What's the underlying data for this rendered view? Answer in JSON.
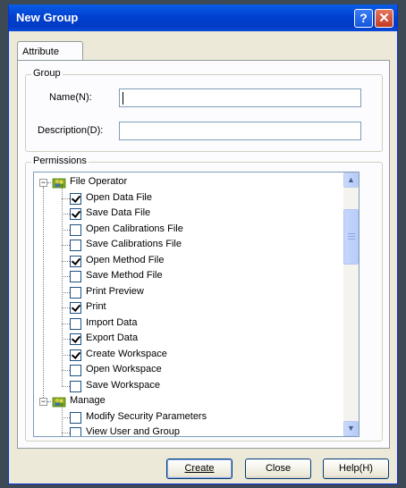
{
  "window": {
    "title": "New Group"
  },
  "title_buttons": {
    "help_glyph": "?",
    "close_glyph": "✕"
  },
  "tabs": [
    {
      "label": "Attribute"
    }
  ],
  "group": {
    "legend": "Group",
    "name_label": "Name(N):",
    "name_value": "",
    "description_label": "Description(D):",
    "description_value": ""
  },
  "permissions": {
    "legend": "Permissions",
    "tree": [
      {
        "label": "File Operator",
        "type": "group",
        "expanded": true,
        "icon": "users-folder-icon"
      },
      {
        "label": "Open Data File",
        "checked": true
      },
      {
        "label": "Save Data File",
        "checked": true
      },
      {
        "label": "Open Calibrations File",
        "checked": false
      },
      {
        "label": "Save Calibrations File",
        "checked": false
      },
      {
        "label": "Open Method File",
        "checked": true
      },
      {
        "label": "Save Method File",
        "checked": false
      },
      {
        "label": "Print Preview",
        "checked": false
      },
      {
        "label": "Print",
        "checked": true
      },
      {
        "label": "Import Data",
        "checked": false
      },
      {
        "label": "Export Data",
        "checked": true
      },
      {
        "label": "Create Workspace",
        "checked": true
      },
      {
        "label": "Open Workspace",
        "checked": false
      },
      {
        "label": "Save Workspace",
        "checked": false
      },
      {
        "label": "Manage",
        "type": "group",
        "expanded": true,
        "icon": "users-folder-icon"
      },
      {
        "label": "Modify Security Parameters",
        "checked": false
      },
      {
        "label": "View User and Group",
        "checked": false
      }
    ],
    "scroll_position": 0.12
  },
  "buttons": {
    "create": "Create",
    "close": "Close",
    "help": "Help(H)"
  },
  "colors": {
    "titlebar": "#0a5de8",
    "dialog_bg": "#ece9d8",
    "folder_icon": "#7fb01e"
  }
}
